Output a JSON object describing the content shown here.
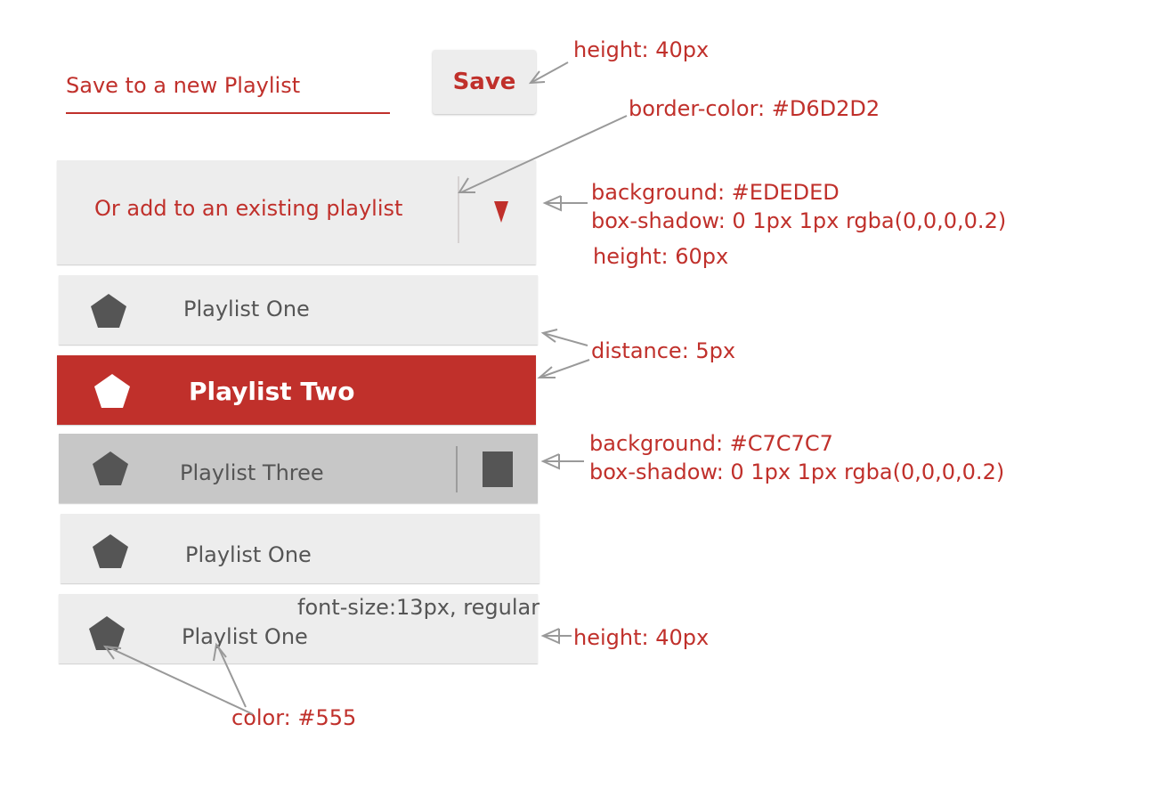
{
  "form": {
    "new_playlist_placeholder": "Save to a new Playlist",
    "save_label": "Save"
  },
  "dropdown": {
    "label": "Or add to an existing playlist"
  },
  "playlists": [
    {
      "name": "Playlist One",
      "state": "default"
    },
    {
      "name": "Playlist Two",
      "state": "active"
    },
    {
      "name": "Playlist Three",
      "state": "hover"
    },
    {
      "name": "Playlist One",
      "state": "default"
    },
    {
      "name": "Playlist One",
      "state": "default"
    }
  ],
  "annotations": {
    "save_height": "height: 40px",
    "border_color": "border-color: #D6D2D2",
    "dropdown_bg": "background: #EDEDED",
    "dropdown_shadow": "box-shadow: 0 1px 1px rgba(0,0,0,0.2)",
    "dropdown_height": "height: 60px",
    "distance": "distance: 5px",
    "hover_bg": "background: #C7C7C7",
    "hover_shadow": "box-shadow: 0 1px 1px rgba(0,0,0,0.2)",
    "font_size": "font-size:13px, regular",
    "item_height": "height: 40px",
    "color": "color: #555"
  },
  "colors": {
    "accent": "#C0302B",
    "item_bg": "#EDEDED",
    "hover_bg": "#C7C7C7",
    "border": "#D6D2D2",
    "text": "#555555"
  }
}
